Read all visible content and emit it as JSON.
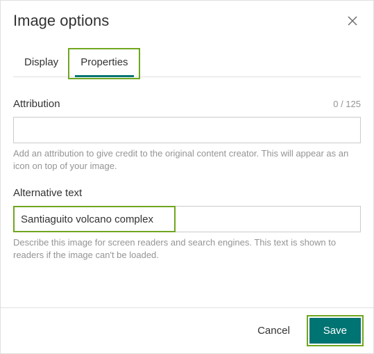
{
  "dialog": {
    "title": "Image options"
  },
  "tabs": {
    "display": "Display",
    "properties": "Properties",
    "active": "properties"
  },
  "attribution": {
    "label": "Attribution",
    "counter": "0 / 125",
    "value": "",
    "placeholder": "",
    "helper": "Add an attribution to give credit to the original content creator. This will appear as an icon on top of your image."
  },
  "alt_text": {
    "label": "Alternative text",
    "value": "Santiaguito volcano complex",
    "helper": "Describe this image for screen readers and search engines. This text is shown to readers if the image can't be loaded."
  },
  "footer": {
    "cancel": "Cancel",
    "save": "Save"
  },
  "colors": {
    "accent": "#007472",
    "highlight_border": "#6fa61e"
  }
}
